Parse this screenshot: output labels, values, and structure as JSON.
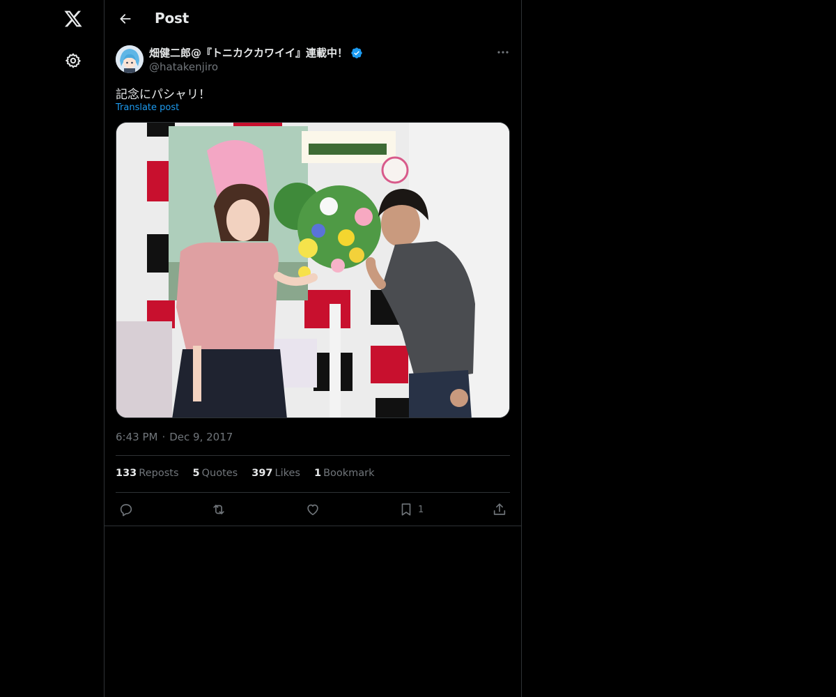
{
  "nav": {
    "logo_icon": "x-logo-icon",
    "settings_icon": "gear-icon"
  },
  "header": {
    "back_icon": "arrow-left-icon",
    "title": "Post"
  },
  "post": {
    "author": {
      "display_name": "畑健二郎@『トニカクカワイイ』連載中！",
      "handle": "@hatakenjiro",
      "verified": true
    },
    "text": "記念にパシャリ！",
    "translate_label": "Translate post",
    "time": "6:43 PM",
    "separator": "·",
    "date": "Dec 9, 2017",
    "stats": {
      "reposts_count": "133",
      "reposts_label": "Reposts",
      "quotes_count": "5",
      "quotes_label": "Quotes",
      "likes_count": "397",
      "likes_label": "Likes",
      "bookmarks_count": "1",
      "bookmarks_label": "Bookmark"
    },
    "actions": {
      "bookmark_count": "1"
    }
  },
  "colors": {
    "background": "#000000",
    "text": "#e7e9ea",
    "muted": "#71767b",
    "accent": "#1d9bf0",
    "border": "#2f3336"
  }
}
